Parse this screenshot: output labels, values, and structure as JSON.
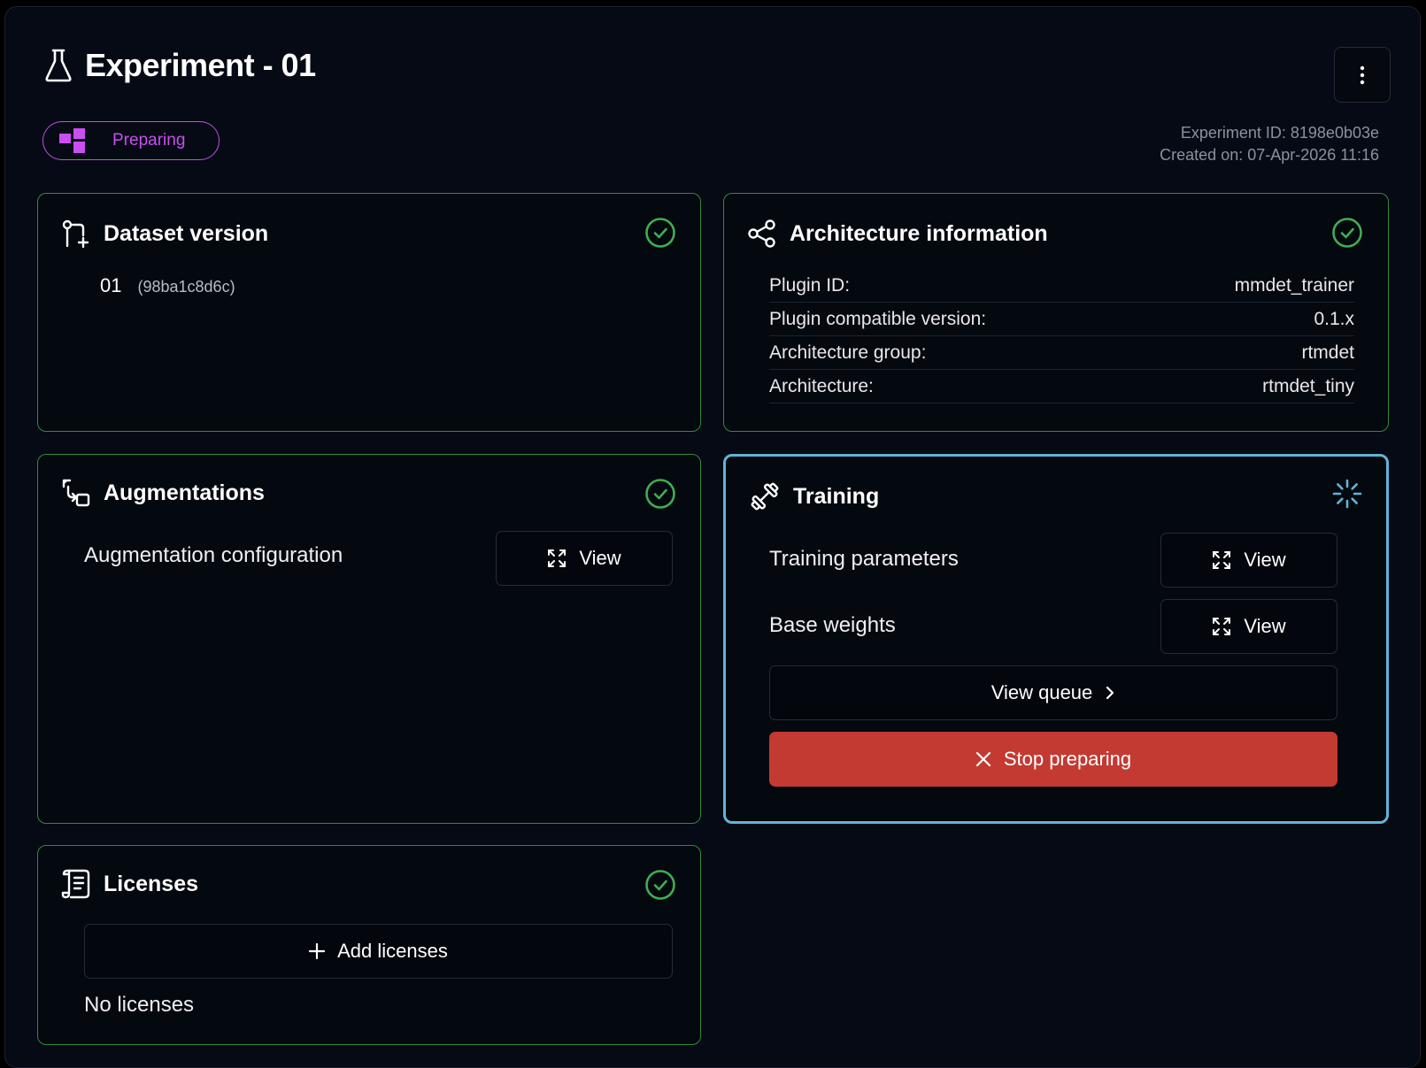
{
  "header": {
    "title": "Experiment - 01",
    "status": "Preparing",
    "experiment_id": "Experiment ID: 8198e0b03e",
    "created_on": "Created on: 07-Apr-2026 11:16"
  },
  "dataset": {
    "title": "Dataset version",
    "version": "01",
    "hash": "(98ba1c8d6c)"
  },
  "architecture": {
    "title": "Architecture information",
    "rows": [
      {
        "label": "Plugin ID:",
        "value": "mmdet_trainer"
      },
      {
        "label": "Plugin compatible version:",
        "value": "0.1.x"
      },
      {
        "label": "Architecture group:",
        "value": "rtmdet"
      },
      {
        "label": "Architecture:",
        "value": "rtmdet_tiny"
      }
    ]
  },
  "augmentations": {
    "title": "Augmentations",
    "config_label": "Augmentation configuration",
    "view_label": "View"
  },
  "training": {
    "title": "Training",
    "params_label": "Training parameters",
    "weights_label": "Base weights",
    "view_label": "View",
    "queue_label": "View queue",
    "stop_label": "Stop preparing"
  },
  "licenses": {
    "title": "Licenses",
    "add_label": "Add licenses",
    "empty_label": "No licenses"
  },
  "colors": {
    "success": "#3fae4f",
    "status_accent": "#c24ee8",
    "active_border": "#5fb4d8",
    "danger": "#c33a32"
  }
}
